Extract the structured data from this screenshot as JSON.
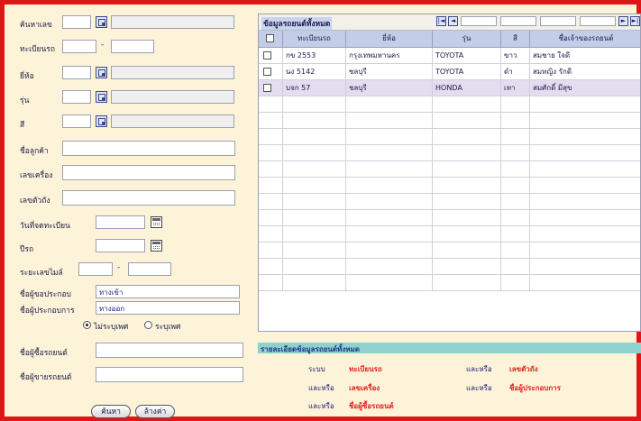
{
  "left_form": {
    "fields": [
      {
        "label": "ค้นหาเลข"
      },
      {
        "label": "ทะเบียนรถ"
      },
      {
        "label": "ยี่ห้อ"
      },
      {
        "label": "รุ่น"
      },
      {
        "label": "สี"
      },
      {
        "label": "ชื่อลูกค้า"
      },
      {
        "label": "เลขเครื่อง"
      },
      {
        "label": "เลขตัวถัง"
      },
      {
        "label": "วันที่จดทะเบียน"
      },
      {
        "label": "ปีรถ"
      },
      {
        "label": "ระยะเลขไมล์"
      },
      {
        "label": "ชื่อผู้ขอประกอบ",
        "value": "ทางเข้า"
      },
      {
        "label": "ชื่อผู้ประกอบการ",
        "value": "ทางออก"
      },
      {
        "label": "ชื่อผู้ซื้อรถยนต์"
      },
      {
        "label": "ชื่อผู้ขายรถยนต์"
      }
    ],
    "separator": "-",
    "radio": {
      "option1": "ไม่ระบุเพศ",
      "option2": "ระบุเพศ",
      "selected": "option1"
    },
    "buttons": {
      "search": "ค้นหา",
      "clear": "ล้างค่า"
    }
  },
  "grid": {
    "title": "ข้อมูลรถยนต์ทั้งหมด",
    "nav": {
      "first": "|◄",
      "prev": "◄",
      "next": "►",
      "last": "►|"
    },
    "columns": [
      "ทะเบียนรถ",
      "ยี่ห้อ",
      "รุ่น",
      "สี",
      "ชื่อเจ้าของรถยนต์"
    ],
    "rows": [
      {
        "plate": "กข 2553",
        "brand": "กรุงเทพมหานคร",
        "model": "TOYOTA",
        "color": "ขาว",
        "owner": "สมชาย ใจดี"
      },
      {
        "plate": "นง 5142",
        "brand": "ชลบุรี",
        "model": "TOYOTA",
        "color": "ดำ",
        "owner": "สมหญิง รักดี"
      },
      {
        "plate": "บจก 57",
        "brand": "ชลบุรี",
        "model": "HONDA",
        "color": "เทา",
        "owner": "สมศักดิ์ มีสุข"
      }
    ],
    "empty_row_count": 12,
    "selected_row_color": "#e4dcef"
  },
  "legend": {
    "title": "รายละเอียดข้อมูลรถยนต์ทั้งหมด",
    "items": [
      {
        "key": "ระบบ",
        "value": "ทะเบียนรถ"
      },
      {
        "key": "และหรือ",
        "value": "เลขเครื่อง"
      },
      {
        "key": "และหรือ",
        "value": "เลขตัวถัง"
      },
      {
        "key": "และหรือ",
        "value": "ชื่อผู้ประกอบการ"
      },
      {
        "key": "และหรือ",
        "value": "ชื่อผู้ซื้อรถยนต์"
      }
    ]
  },
  "colors": {
    "frame": "#e01616",
    "panel": "#fcf3d8",
    "header": "#c3cde8",
    "legend_bar": "#8fd1cc",
    "legend_value": "#e02020"
  }
}
